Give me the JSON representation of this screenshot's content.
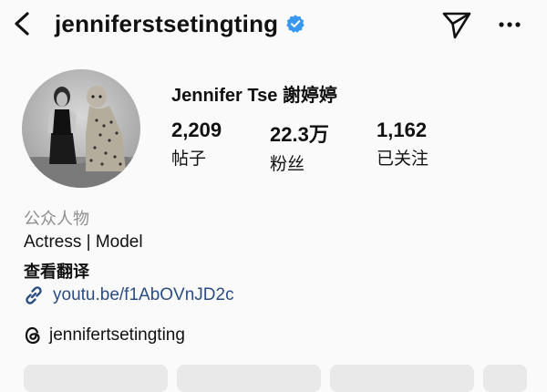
{
  "header": {
    "username": "jenniferstsetingting",
    "verified": true
  },
  "profile": {
    "display_name": "Jennifer Tse 謝婷婷",
    "stats": [
      {
        "value": "2,209",
        "label": "帖子"
      },
      {
        "value": "22.3万",
        "label": "粉丝"
      },
      {
        "value": "1,162",
        "label": "已关注"
      }
    ],
    "category": "公众人物",
    "bio": "Actress | Model",
    "translate_label": "查看翻译",
    "link": "youtu.be/f1AbOVnJD2c",
    "threads_handle": "jennifertsetingting"
  },
  "colors": {
    "verified_badge": "#3897f0",
    "link": "#2c4d84",
    "category_text": "#8e8e8e",
    "button_bg": "#e9e9e9"
  },
  "icons": [
    "back-arrow-icon",
    "verified-badge-icon",
    "send-icon",
    "more-icon",
    "link-icon",
    "threads-icon"
  ]
}
